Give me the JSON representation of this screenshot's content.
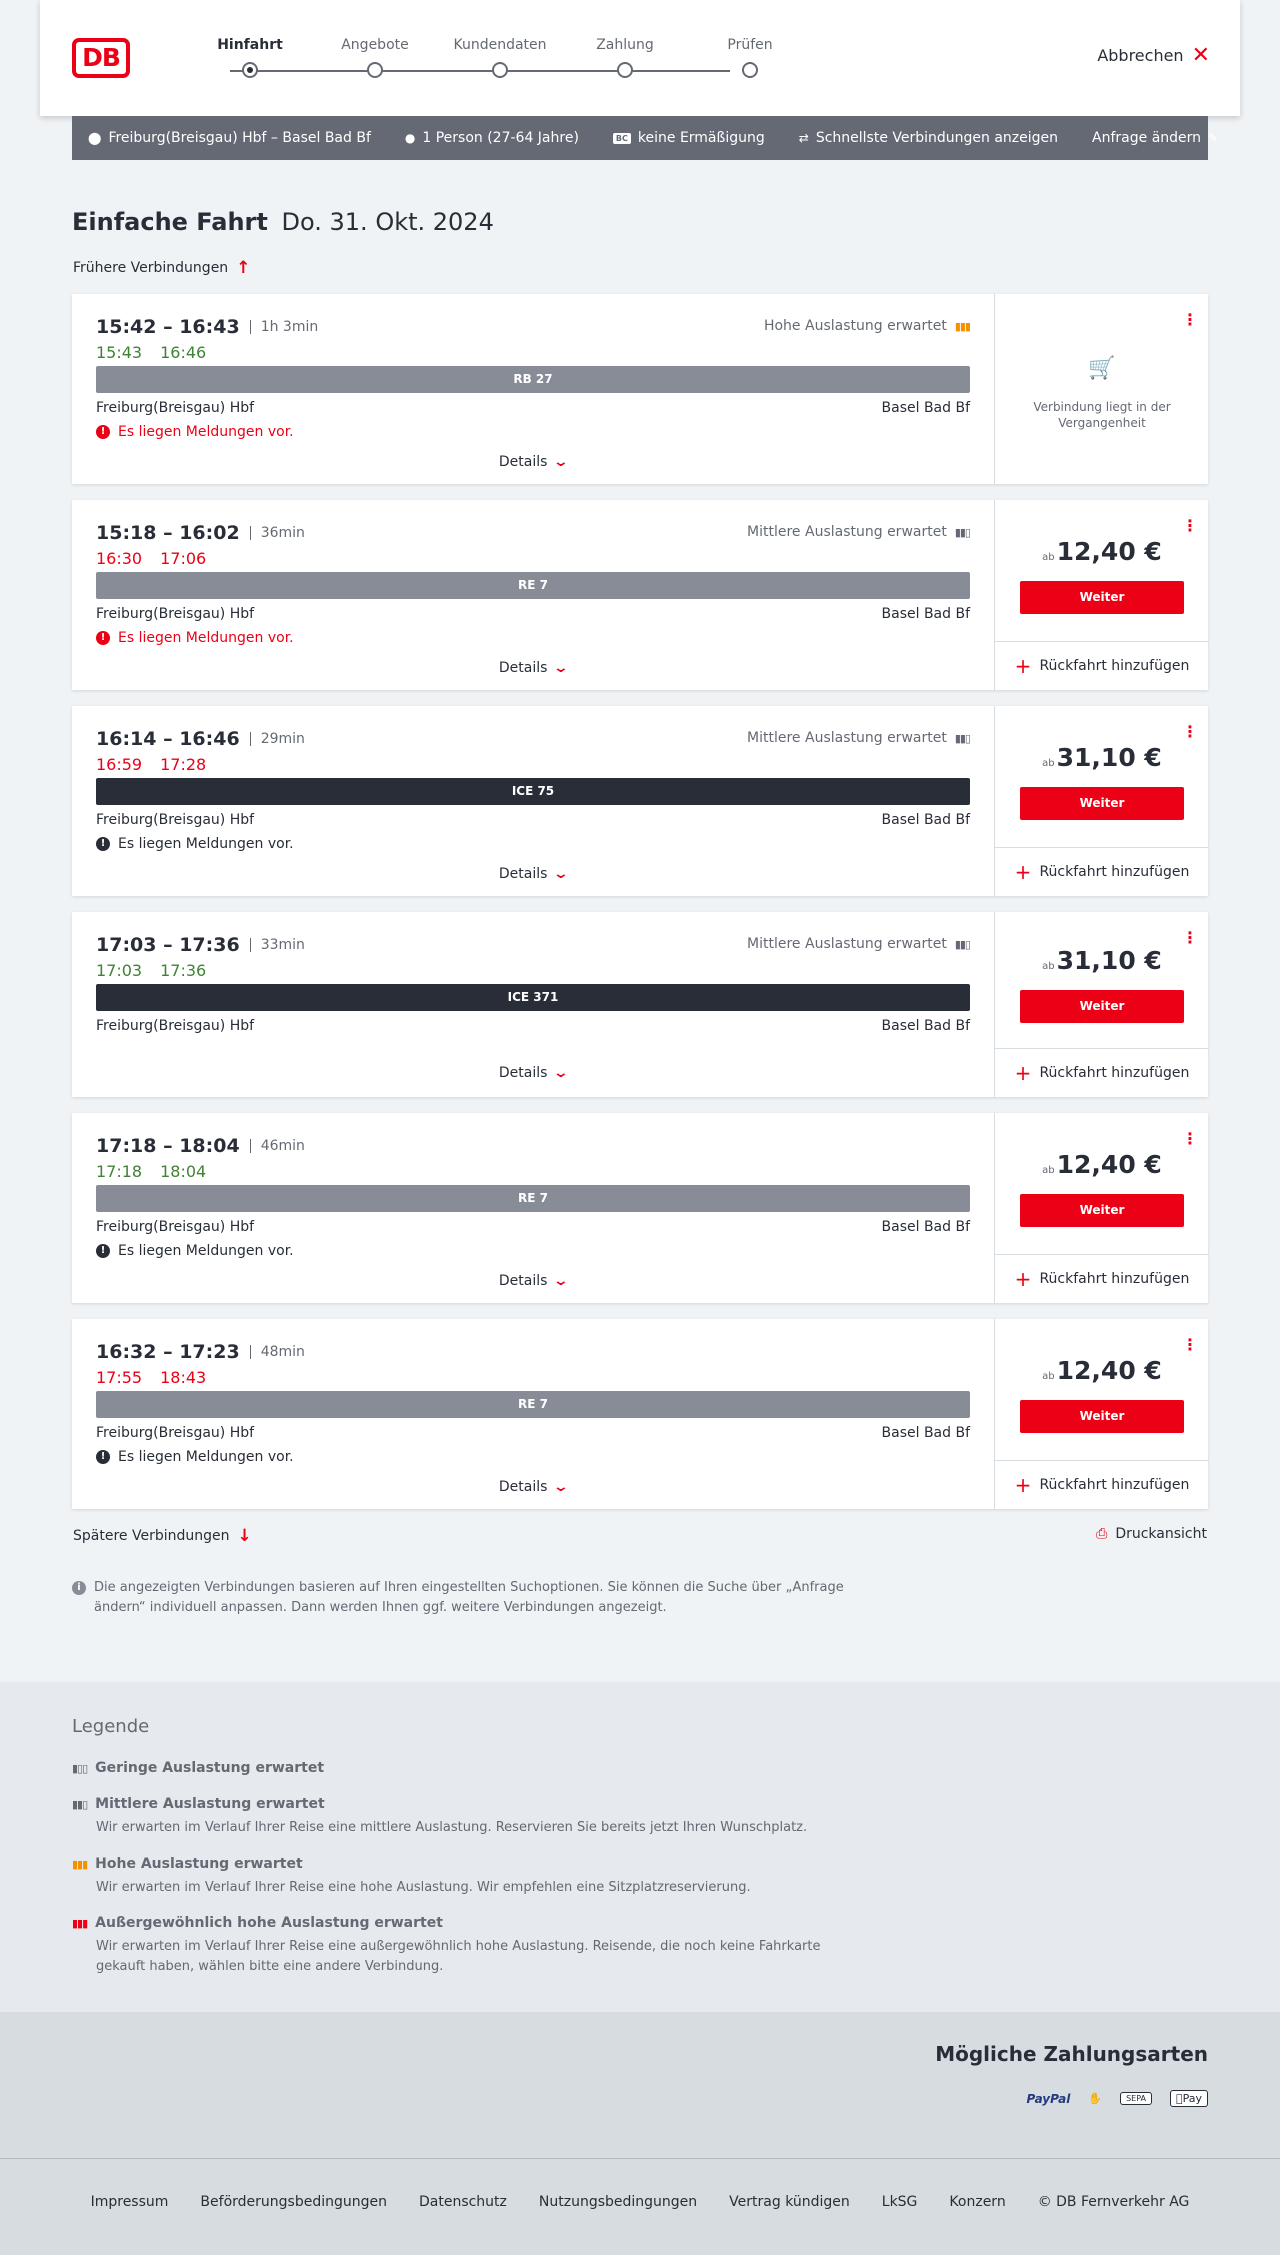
{
  "header": {
    "logo": "DB",
    "steps": [
      {
        "label": "Hinfahrt",
        "active": true
      },
      {
        "label": "Angebote",
        "active": false
      },
      {
        "label": "Kundendaten",
        "active": false
      },
      {
        "label": "Zahlung",
        "active": false
      },
      {
        "label": "Prüfen",
        "active": false
      }
    ],
    "cancel_label": "Abbrechen"
  },
  "search": {
    "route": "Freiburg(Breisgau) Hbf – Basel Bad Bf",
    "passengers": "1 Person (27-64 Jahre)",
    "discount": "keine Ermäßigung",
    "discount_badge": "BC",
    "fastest": "Schnellste Verbindungen anzeigen",
    "change": "Anfrage ändern"
  },
  "page": {
    "title": "Einfache Fahrt",
    "date": "Do. 31. Okt. 2024",
    "earlier": "Frühere Verbindungen",
    "later": "Spätere Verbindungen",
    "print": "Druckansicht",
    "info": "Die angezeigten Verbindungen basieren auf Ihren eingestellten Suchoptionen. Sie können die Suche über „Anfrage ändern“ individuell anpassen. Dann werden Ihnen ggf. weitere Verbindungen angezeigt."
  },
  "connections": [
    {
      "times": "15:42 – 16:43",
      "duration": "1h 3min",
      "actual_dep": "15:43",
      "actual_arr": "16:46",
      "actual_color": "green",
      "load": "Hohe Auslastung erwartet",
      "load_level": "high",
      "train": "RB 27",
      "train_kind": "regional",
      "from": "Freiburg(Breisgau) Hbf",
      "to": "Basel Bad Bf",
      "message": "Es liegen Meldungen vor.",
      "message_color": "red",
      "details": "Details",
      "past": true,
      "past_text": "Verbindung liegt in der Vergangenheit"
    },
    {
      "times": "15:18 – 16:02",
      "duration": "36min",
      "actual_dep": "16:30",
      "actual_arr": "17:06",
      "actual_color": "red",
      "load": "Mittlere Auslastung erwartet",
      "load_level": "mid",
      "train": "RE 7",
      "train_kind": "regional",
      "from": "Freiburg(Breisgau) Hbf",
      "to": "Basel Bad Bf",
      "message": "Es liegen Meldungen vor.",
      "message_color": "red",
      "details": "Details",
      "price_prefix": "ab",
      "price": "12,40 €",
      "button": "Weiter",
      "return": "Rückfahrt hinzufügen"
    },
    {
      "times": "16:14 – 16:46",
      "duration": "29min",
      "actual_dep": "16:59",
      "actual_arr": "17:28",
      "actual_color": "red",
      "load": "Mittlere Auslastung erwartet",
      "load_level": "mid",
      "train": "ICE 75",
      "train_kind": "ice",
      "from": "Freiburg(Breisgau) Hbf",
      "to": "Basel Bad Bf",
      "message": "Es liegen Meldungen vor.",
      "message_color": "black",
      "details": "Details",
      "price_prefix": "ab",
      "price": "31,10 €",
      "button": "Weiter",
      "return": "Rückfahrt hinzufügen"
    },
    {
      "times": "17:03 – 17:36",
      "duration": "33min",
      "actual_dep": "17:03",
      "actual_arr": "17:36",
      "actual_color": "green",
      "load": "Mittlere Auslastung erwartet",
      "load_level": "mid",
      "train": "ICE 371",
      "train_kind": "ice",
      "from": "Freiburg(Breisgau) Hbf",
      "to": "Basel Bad Bf",
      "message": "",
      "message_color": "none",
      "details": "Details",
      "price_prefix": "ab",
      "price": "31,10 €",
      "button": "Weiter",
      "return": "Rückfahrt hinzufügen"
    },
    {
      "times": "17:18 – 18:04",
      "duration": "46min",
      "actual_dep": "17:18",
      "actual_arr": "18:04",
      "actual_color": "green",
      "load": "",
      "load_level": "none",
      "train": "RE 7",
      "train_kind": "regional",
      "from": "Freiburg(Breisgau) Hbf",
      "to": "Basel Bad Bf",
      "message": "Es liegen Meldungen vor.",
      "message_color": "black",
      "details": "Details",
      "price_prefix": "ab",
      "price": "12,40 €",
      "button": "Weiter",
      "return": "Rückfahrt hinzufügen"
    },
    {
      "times": "16:32 – 17:23",
      "duration": "48min",
      "actual_dep": "17:55",
      "actual_arr": "18:43",
      "actual_color": "red",
      "load": "",
      "load_level": "none",
      "train": "RE 7",
      "train_kind": "regional",
      "from": "Freiburg(Breisgau) Hbf",
      "to": "Basel Bad Bf",
      "message": "Es liegen Meldungen vor.",
      "message_color": "black",
      "details": "Details",
      "price_prefix": "ab",
      "price": "12,40 €",
      "button": "Weiter",
      "return": "Rückfahrt hinzufügen"
    }
  ],
  "legend": {
    "title": "Legende",
    "items": [
      {
        "title": "Geringe Auslastung erwartet",
        "desc": "",
        "level": "low"
      },
      {
        "title": "Mittlere Auslastung erwartet",
        "desc": "Wir erwarten im Verlauf Ihrer Reise eine mittlere Auslastung. Reservieren Sie bereits jetzt Ihren Wunschplatz.",
        "level": "mid"
      },
      {
        "title": "Hohe Auslastung erwartet",
        "desc": "Wir erwarten im Verlauf Ihrer Reise eine hohe Auslastung. Wir empfehlen eine Sitzplatzreservierung.",
        "level": "high"
      },
      {
        "title": "Außergewöhnlich hohe Auslastung erwartet",
        "desc": "Wir erwarten im Verlauf Ihrer Reise eine außergewöhnlich hohe Auslastung. Reisende, die noch keine Fahrkarte gekauft haben, wählen bitte eine andere Verbindung.",
        "level": "extreme"
      }
    ]
  },
  "payment": {
    "title": "Mögliche Zahlungsarten",
    "methods": [
      "PayPal",
      "Kreditkarte",
      "SEPA",
      "Apple Pay"
    ],
    "applepay_label": "Pay"
  },
  "footer": {
    "links": [
      "Impressum",
      "Beförderungsbedingungen",
      "Datenschutz",
      "Nutzungsbedingungen",
      "Vertrag kündigen",
      "LkSG",
      "Konzern",
      "© DB Fernverkehr AG"
    ]
  },
  "colors": {
    "accent": "#ec0016",
    "text": "#282d37",
    "bar": "#646973",
    "green": "#408335",
    "high_load": "#f39200"
  }
}
